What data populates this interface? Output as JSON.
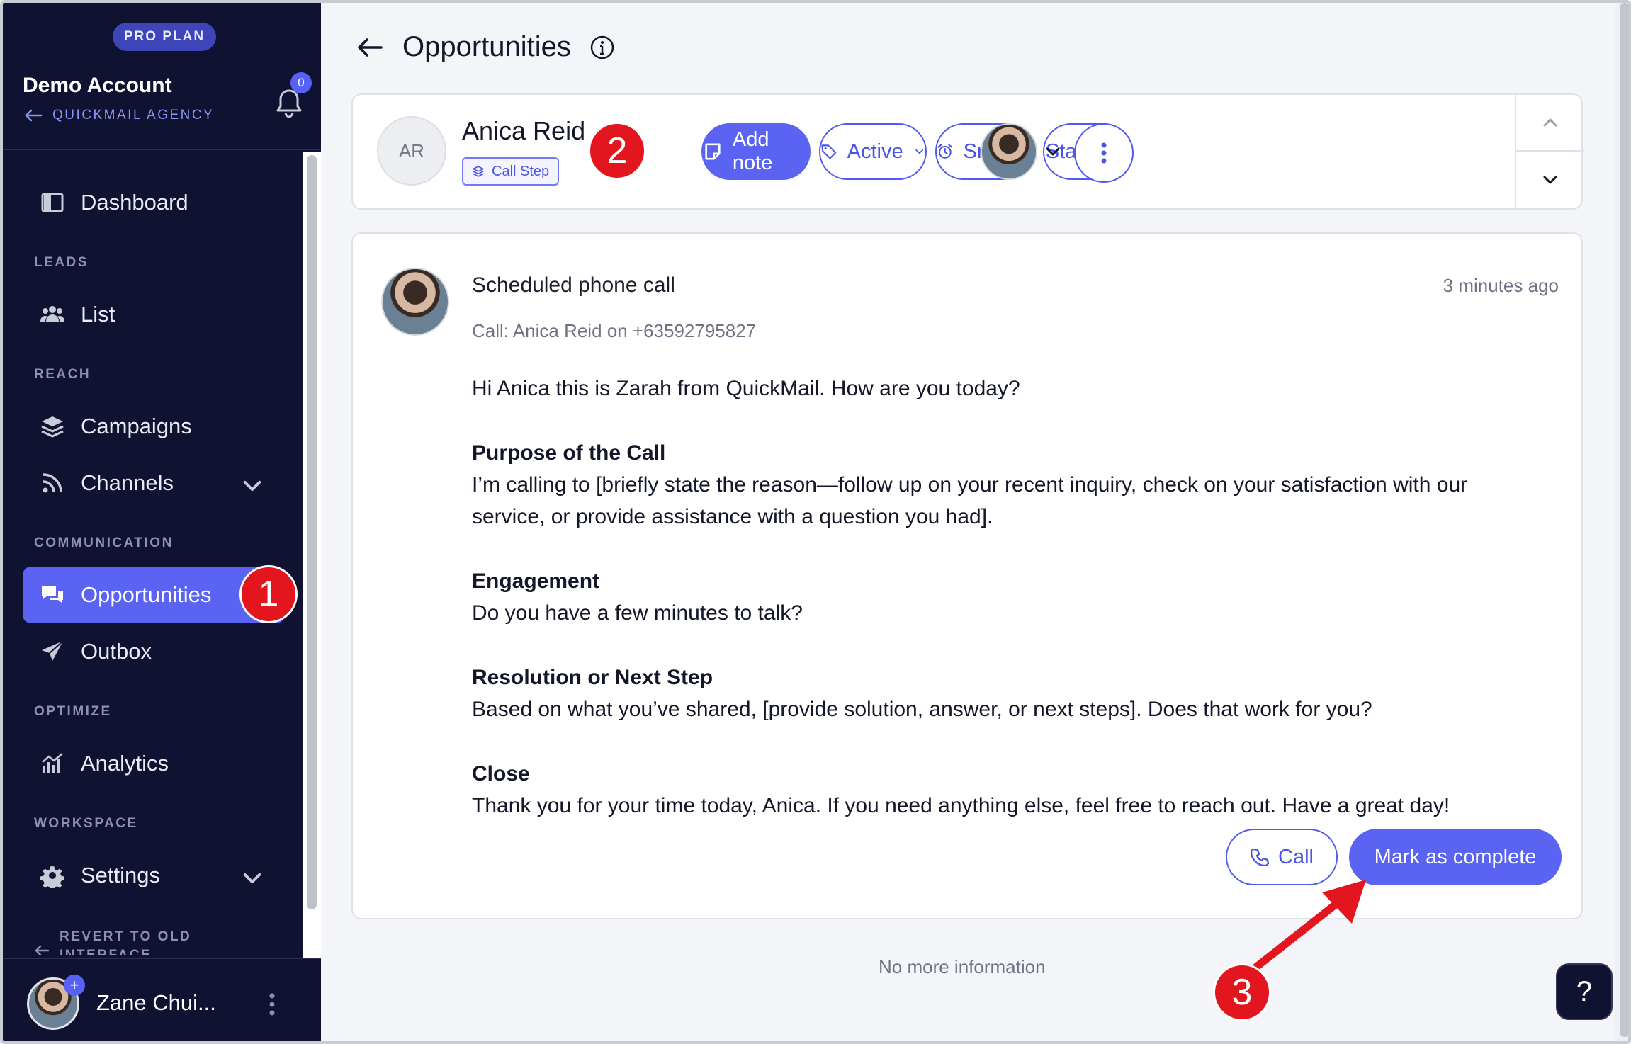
{
  "sidebar": {
    "plan": "PRO PLAN",
    "account_name": "Demo Account",
    "agency": "QUICKMAIL AGENCY",
    "notification_count": "0",
    "dashboard": "Dashboard",
    "leads_section": "LEADS",
    "list": "List",
    "reach_section": "REACH",
    "campaigns": "Campaigns",
    "channels": "Channels",
    "communication_section": "COMMUNICATION",
    "opportunities": "Opportunities",
    "outbox": "Outbox",
    "optimize_section": "OPTIMIZE",
    "analytics": "Analytics",
    "workspace_section": "WORKSPACE",
    "settings": "Settings",
    "revert": "REVERT TO OLD INTERFACE",
    "user_name": "Zane Chui...",
    "user_plus": "+"
  },
  "page": {
    "title": "Opportunities"
  },
  "contact": {
    "initials": "AR",
    "name": "Anica Reid",
    "step_tag": "Call Step",
    "add_note": "Add note",
    "active": "Active",
    "snooze": "Snooze",
    "status": "Status"
  },
  "activity": {
    "title": "Scheduled phone call",
    "time": "3 minutes ago",
    "subtitle": "Call: Anica Reid on +63592795827",
    "greeting": "Hi Anica this is Zarah from QuickMail. How are you today?",
    "purpose_heading": "Purpose of the Call",
    "purpose_text": "I’m calling to [briefly state the reason—follow up on your recent inquiry, check on your satisfaction with our service, or provide assistance with a question you had].",
    "engagement_heading": "Engagement",
    "engagement_text": "Do you have a few minutes to talk?",
    "resolution_heading": "Resolution or Next Step",
    "resolution_text": "Based on what you’ve shared, [provide solution, answer, or next steps]. Does that work for you?",
    "close_heading": "Close",
    "close_text": "Thank you for your time today, Anica. If you need anything else, feel free to reach out. Have a great day!",
    "call_button": "Call",
    "complete_button": "Mark as complete"
  },
  "footer": {
    "no_more": "No more information",
    "help": "?"
  },
  "annotations": {
    "step1": "1",
    "step2": "2",
    "step3": "3"
  },
  "colors": {
    "accent": "#5a63f2",
    "sidebar_bg": "#0f1230",
    "annotation_red": "#e3151f"
  }
}
